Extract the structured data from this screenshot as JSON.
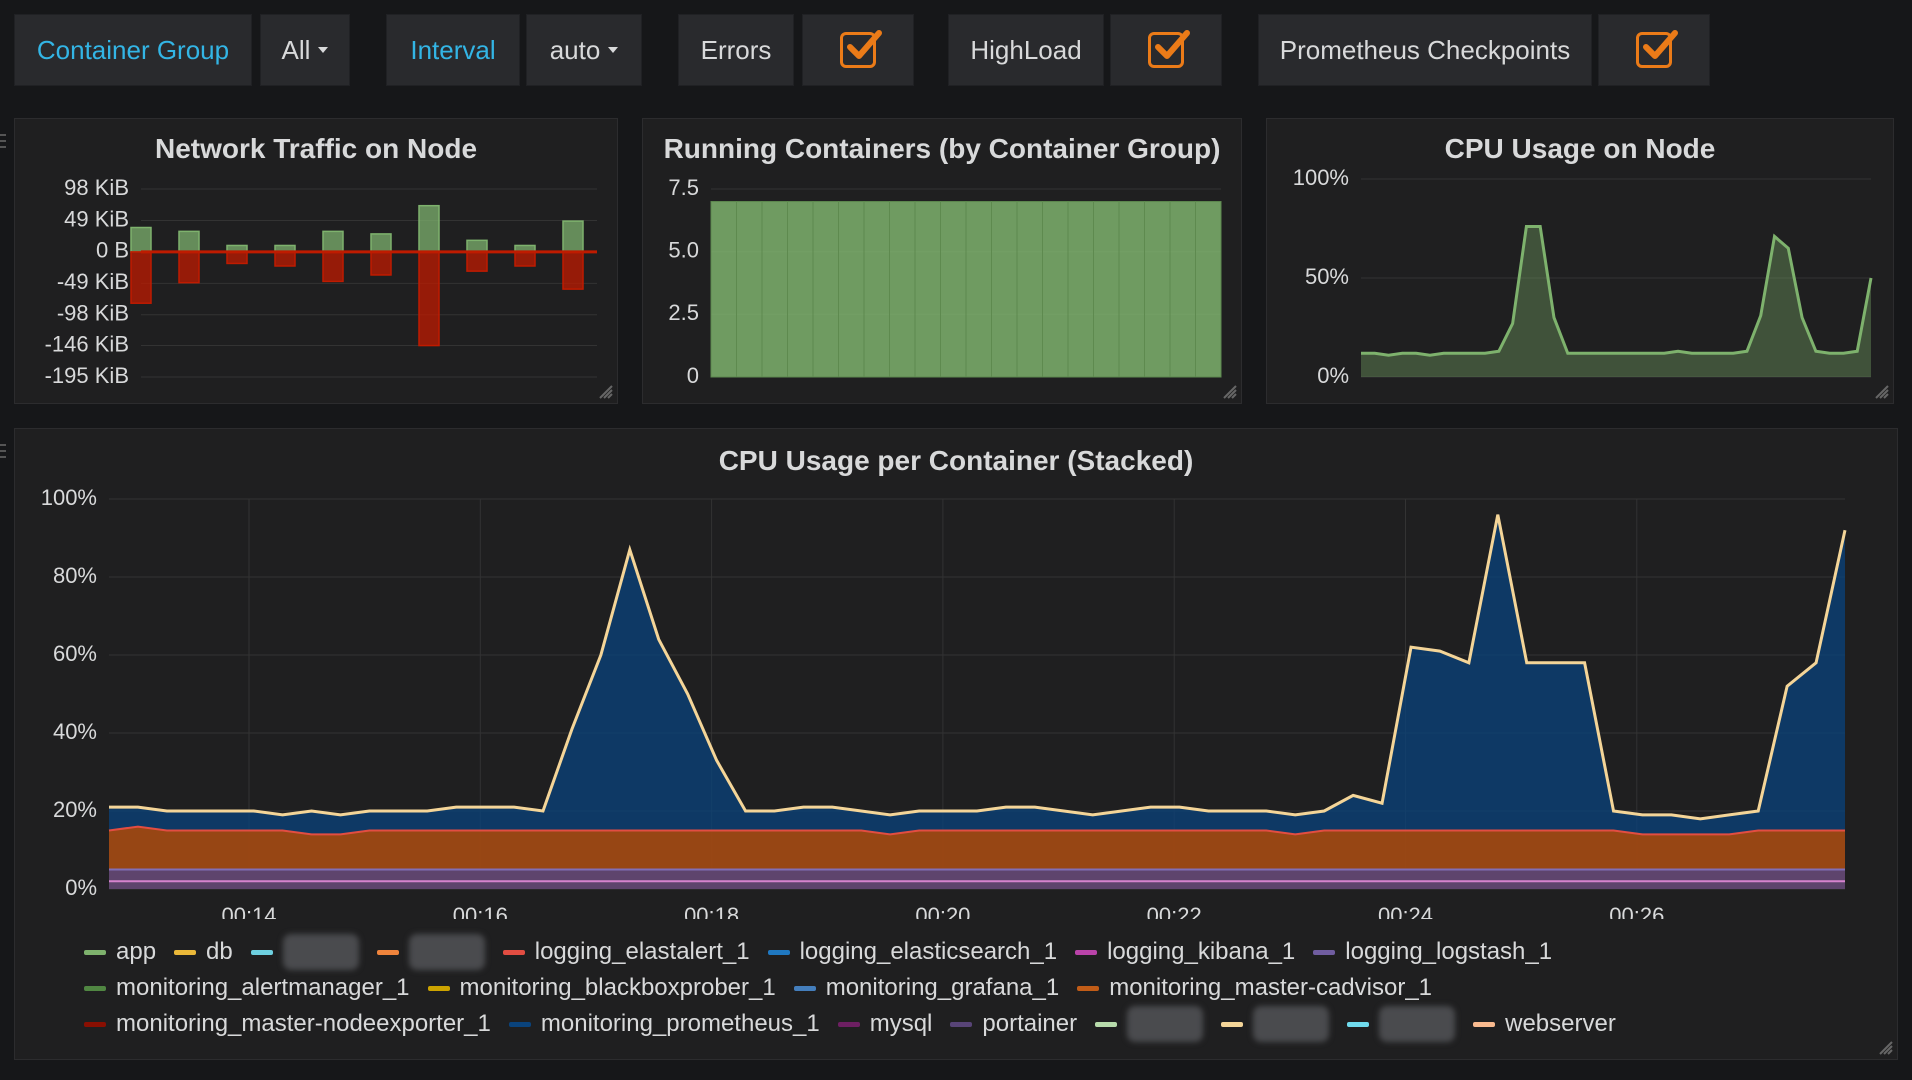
{
  "variables": {
    "container_group_label": "Container Group",
    "container_group_value": "All",
    "interval_label": "Interval",
    "interval_value": "auto",
    "errors_label": "Errors",
    "highload_label": "HighLoad",
    "prometheus_label": "Prometheus Checkpoints",
    "errors_checked": true,
    "highload_checked": true,
    "prometheus_checked": true
  },
  "colors": {
    "background": "#161719",
    "panel": "#1f1f20",
    "link": "#33b5e5",
    "checkbox": "#eb7b18",
    "green": "#7eb26d",
    "red": "#bf1b00",
    "navy": "#0a437c",
    "orange": "#ba4a00"
  },
  "panels": {
    "network": {
      "title": "Network Traffic on Node"
    },
    "containers": {
      "title": "Running Containers (by Container Group)"
    },
    "cpu_node": {
      "title": "CPU Usage on Node"
    },
    "cpu_container": {
      "title": "CPU Usage per Container (Stacked)"
    }
  },
  "chart_data": [
    {
      "id": "network",
      "type": "bar",
      "title": "Network Traffic on Node",
      "y_ticks": [
        "98 KiB",
        "49 KiB",
        "0 B",
        "-49 KiB",
        "-98 KiB",
        "-146 KiB",
        "-195 KiB"
      ],
      "y_tick_values": [
        98,
        49,
        0,
        -49,
        -98,
        -146,
        -195
      ],
      "ylim": [
        -195,
        98
      ],
      "unit": "KiB",
      "series": [
        {
          "values": [
            38,
            32,
            10,
            10,
            32,
            28,
            72,
            18,
            10,
            48
          ],
          "color": "#7eb26d"
        },
        {
          "values": [
            -80,
            -48,
            -18,
            -22,
            -46,
            -36,
            -146,
            -30,
            -22,
            -58
          ],
          "color": "#bf1b00"
        }
      ]
    },
    {
      "id": "containers",
      "type": "bar",
      "title": "Running Containers (by Container Group)",
      "y_ticks": [
        "7.5",
        "5.0",
        "2.5",
        "0"
      ],
      "y_tick_values": [
        7.5,
        5.0,
        2.5,
        0
      ],
      "ylim": [
        0,
        7.5
      ],
      "values": [
        7,
        7,
        7,
        7,
        7,
        7,
        7,
        7,
        7,
        7,
        7,
        7,
        7,
        7,
        7,
        7,
        7,
        7,
        7,
        7
      ],
      "color": "#7eb26d"
    },
    {
      "id": "cpu_node",
      "type": "area",
      "title": "CPU Usage on Node",
      "y_ticks": [
        "100%",
        "50%",
        "0%"
      ],
      "y_tick_values": [
        100,
        50,
        0
      ],
      "ylim": [
        0,
        100
      ],
      "values": [
        12,
        12,
        11,
        12,
        12,
        11,
        12,
        12,
        12,
        12,
        13,
        27,
        76,
        76,
        30,
        12,
        12,
        12,
        12,
        12,
        12,
        12,
        12,
        13,
        12,
        12,
        12,
        12,
        13,
        31,
        71,
        65,
        30,
        13,
        12,
        12,
        13,
        50
      ],
      "color": "#7eb26d"
    },
    {
      "id": "cpu_container",
      "type": "area",
      "title": "CPU Usage per Container (Stacked)",
      "stacked": true,
      "y_ticks": [
        "100%",
        "80%",
        "60%",
        "40%",
        "20%",
        "0%"
      ],
      "y_tick_values": [
        100,
        80,
        60,
        40,
        20,
        0
      ],
      "ylim": [
        0,
        100
      ],
      "x_ticks": [
        "00:14",
        "00:16",
        "00:18",
        "00:20",
        "00:22",
        "00:24",
        "00:26"
      ],
      "totals": [
        21,
        21,
        20,
        20,
        20,
        20,
        19,
        20,
        19,
        20,
        20,
        20,
        21,
        21,
        21,
        20,
        41,
        60,
        87,
        64,
        50,
        33,
        20,
        20,
        21,
        21,
        20,
        19,
        20,
        20,
        20,
        21,
        21,
        20,
        19,
        20,
        21,
        21,
        20,
        20,
        20,
        19,
        20,
        24,
        22,
        62,
        61,
        58,
        96,
        58,
        58,
        58,
        20,
        19,
        19,
        18,
        19,
        20,
        52,
        58,
        92
      ],
      "series": [
        {
          "name": "monitoring_master-cadvisor_1",
          "values": [
            10,
            11,
            10,
            10,
            10,
            10,
            10,
            9,
            9,
            10,
            10,
            10,
            10,
            10,
            10,
            10,
            10,
            10,
            10,
            10,
            10,
            10,
            10,
            10,
            10,
            10,
            10,
            9,
            10,
            10,
            10,
            10,
            10,
            10,
            10,
            10,
            10,
            10,
            10,
            10,
            10,
            9,
            10,
            10,
            10,
            10,
            10,
            10,
            10,
            10,
            10,
            10,
            10,
            9,
            9,
            9,
            9,
            10,
            10,
            10,
            10
          ],
          "color": "#ba4a00"
        },
        {
          "name": "logging_kibana_1",
          "values": [
            2,
            2,
            2,
            2,
            2,
            2,
            2,
            2,
            2,
            2,
            2,
            2,
            2,
            2,
            2,
            2,
            2,
            2,
            2,
            2,
            2,
            2,
            2,
            2,
            2,
            2,
            2,
            2,
            2,
            2,
            2,
            2,
            2,
            2,
            2,
            2,
            2,
            2,
            2,
            2,
            2,
            2,
            2,
            2,
            2,
            2,
            2,
            2,
            2,
            2,
            2,
            2,
            2,
            2,
            2,
            2,
            2,
            2,
            2,
            2,
            2
          ],
          "color": "#d683ce"
        },
        {
          "name": "logging_logstash_1",
          "values": [
            3,
            3,
            3,
            3,
            3,
            3,
            3,
            3,
            3,
            3,
            3,
            3,
            3,
            3,
            3,
            3,
            3,
            3,
            3,
            3,
            3,
            3,
            3,
            3,
            3,
            3,
            3,
            3,
            3,
            3,
            3,
            3,
            3,
            3,
            3,
            3,
            3,
            3,
            3,
            3,
            3,
            3,
            3,
            3,
            3,
            3,
            3,
            3,
            3,
            3,
            3,
            3,
            3,
            3,
            3,
            3,
            3,
            3,
            3,
            3,
            3
          ],
          "color": "#806eb7"
        }
      ],
      "legend": [
        {
          "label": "app",
          "color": "#7eb26d"
        },
        {
          "label": "db",
          "color": "#eab839"
        },
        {
          "label": "",
          "color": "#6ed0e0",
          "hidden": true
        },
        {
          "label": "",
          "color": "#ef843c",
          "hidden": true
        },
        {
          "label": "logging_elastalert_1",
          "color": "#e24d42"
        },
        {
          "label": "logging_elasticsearch_1",
          "color": "#1f78c1"
        },
        {
          "label": "logging_kibana_1",
          "color": "#ba43a9"
        },
        {
          "label": "logging_logstash_1",
          "color": "#705da0"
        },
        {
          "label": "monitoring_alertmanager_1",
          "color": "#508642"
        },
        {
          "label": "monitoring_blackboxprober_1",
          "color": "#cca300"
        },
        {
          "label": "monitoring_grafana_1",
          "color": "#447ebc"
        },
        {
          "label": "monitoring_master-cadvisor_1",
          "color": "#c15c17"
        },
        {
          "label": "monitoring_master-nodeexporter_1",
          "color": "#890f02"
        },
        {
          "label": "monitoring_prometheus_1",
          "color": "#0a437c"
        },
        {
          "label": "mysql",
          "color": "#6d1f62"
        },
        {
          "label": "portainer",
          "color": "#584477"
        },
        {
          "label": "",
          "color": "#b7dbab",
          "hidden": true
        },
        {
          "label": "",
          "color": "#f4d598",
          "hidden": true
        },
        {
          "label": "",
          "color": "#70dbed",
          "hidden": true
        },
        {
          "label": "webserver",
          "color": "#f9ba8f"
        }
      ]
    }
  ]
}
